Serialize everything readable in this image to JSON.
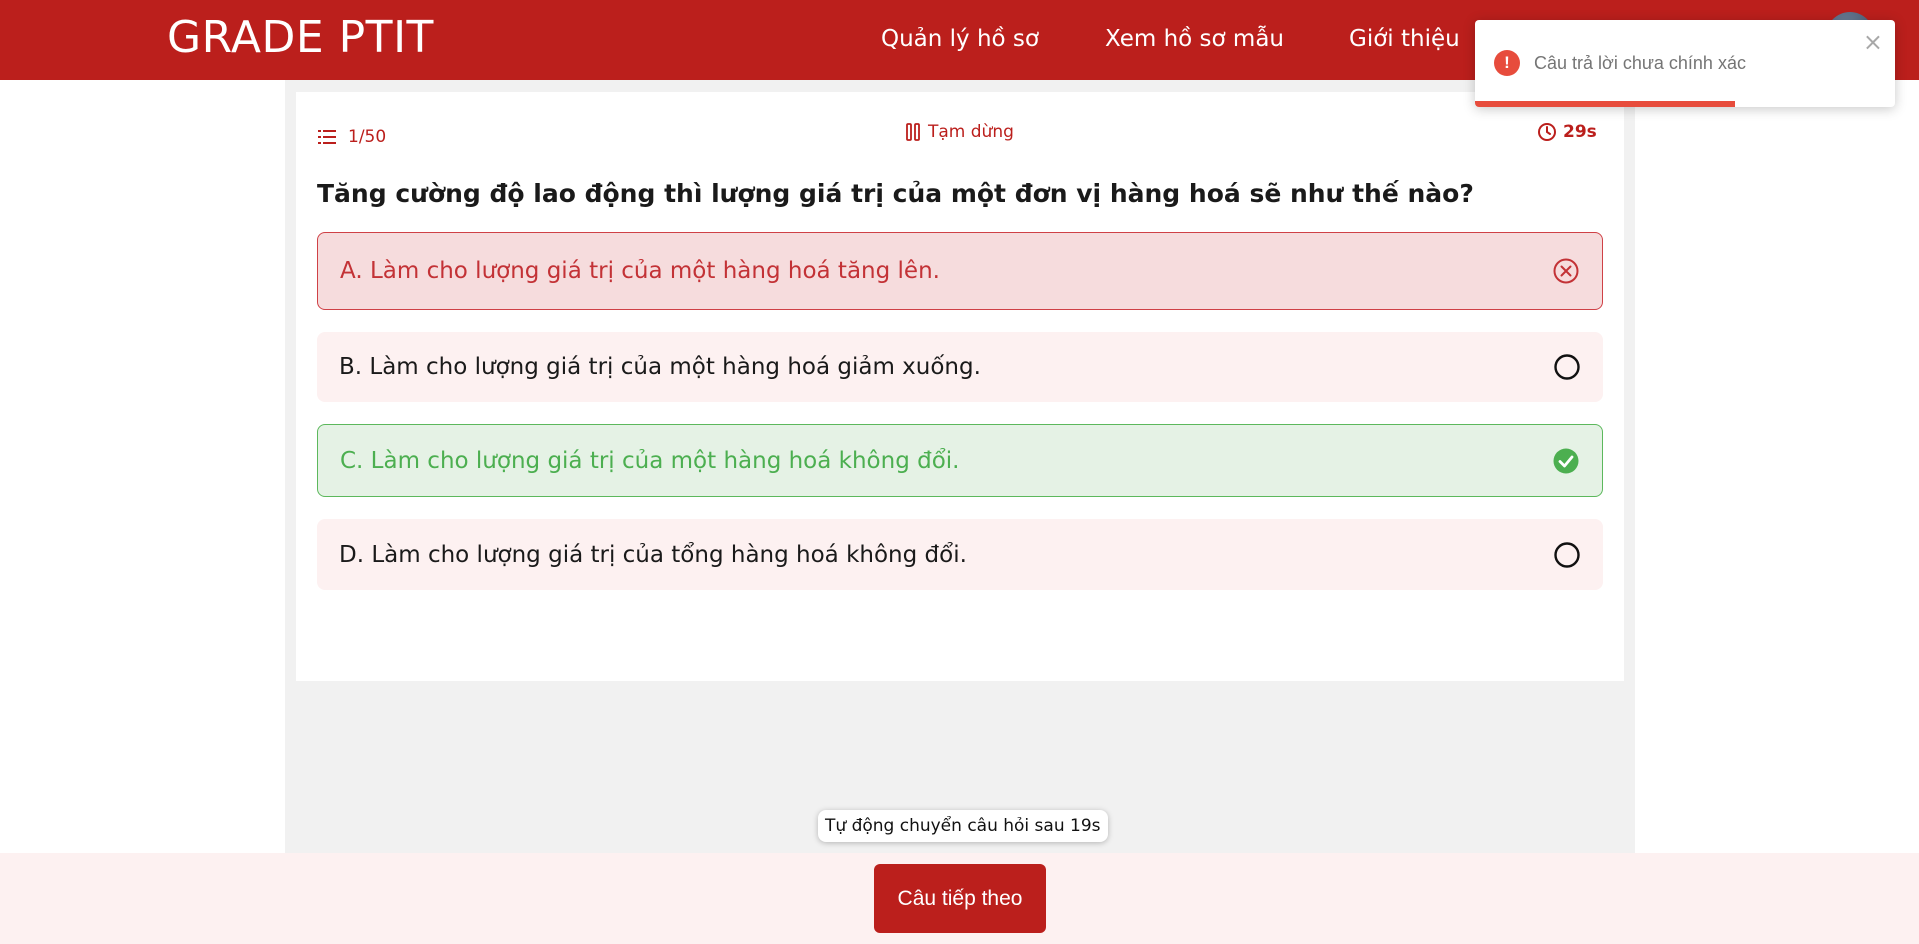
{
  "header": {
    "brand": "GRADE PTIT",
    "nav": [
      "Quản lý hồ sơ",
      "Xem hồ sơ mẫu",
      "Giới thiệu"
    ],
    "partial_text": "~"
  },
  "quiz": {
    "counter": "1/50",
    "pause_label": "Tạm dừng",
    "timer": "29s",
    "question": "Tăng cường độ lao động thì lượng giá trị của một đơn vị hàng hoá sẽ như thế nào?",
    "options": [
      {
        "text": "A. Làm cho lượng giá trị của một hàng hoá tăng lên.",
        "state": "wrong"
      },
      {
        "text": "B. Làm cho lượng giá trị của một hàng hoá giảm xuống.",
        "state": "neutral"
      },
      {
        "text": "C. Làm cho lượng giá trị của một hàng hoá không đổi.",
        "state": "correct"
      },
      {
        "text": "D. Làm cho lượng giá trị của tổng hàng hoá không đổi.",
        "state": "neutral"
      }
    ]
  },
  "footer": {
    "auto_next": "Tự động chuyển câu hỏi sau 19s",
    "next_button": "Câu tiếp theo"
  },
  "toast": {
    "message": "Câu trả lời chưa chính xác",
    "icon": "!",
    "close": "×",
    "progress": 0.62
  },
  "colors": {
    "brand": "#bb1f1c",
    "wrong": "#c33236",
    "correct": "#4caf50",
    "toast_error": "#e74c3c"
  }
}
